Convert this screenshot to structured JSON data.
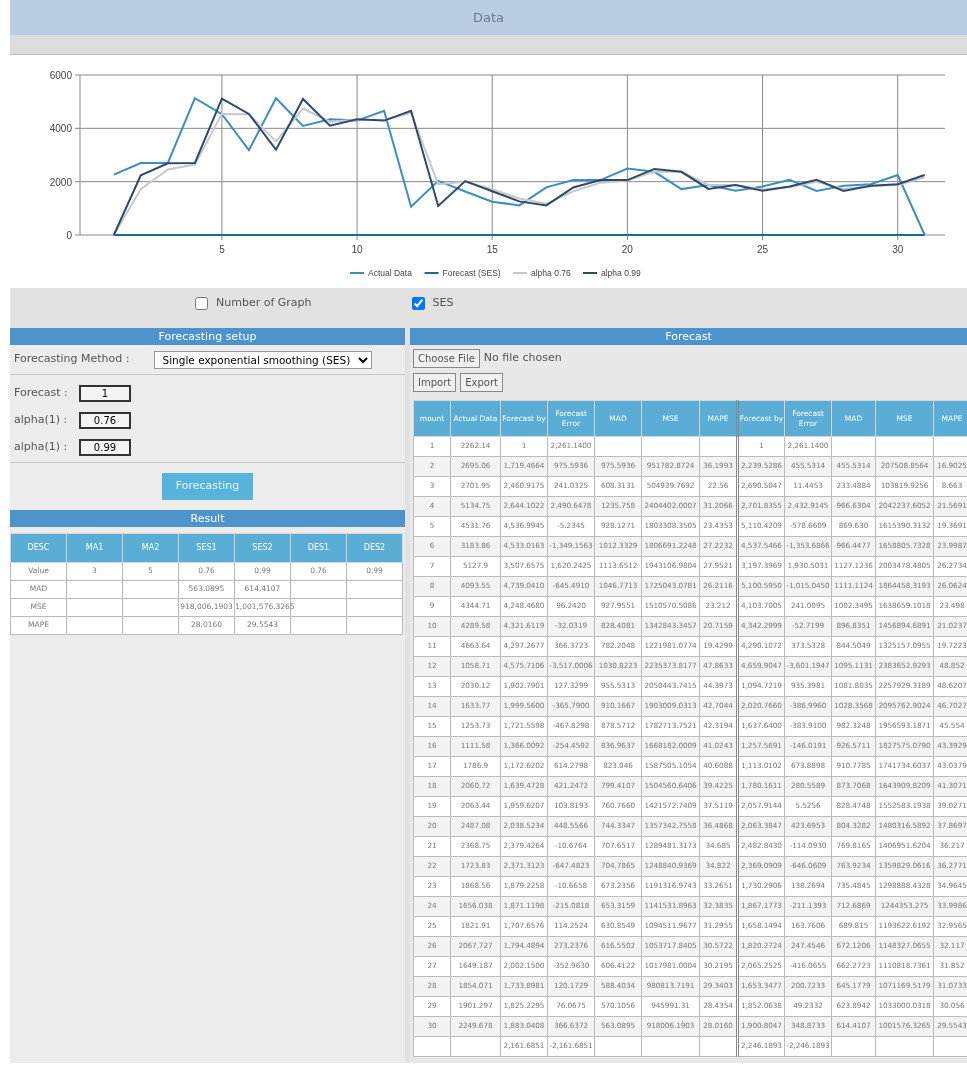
{
  "window": {
    "title": "Data"
  },
  "chart": {
    "chart_data": {
      "type": "line",
      "grid": true,
      "legend": "bottom",
      "x": [
        1,
        2,
        3,
        4,
        5,
        6,
        7,
        8,
        9,
        10,
        11,
        12,
        13,
        14,
        15,
        16,
        17,
        18,
        19,
        20,
        21,
        22,
        23,
        24,
        25,
        26,
        27,
        28,
        29,
        30,
        31
      ],
      "xlim": [
        -0.25,
        31.75
      ],
      "ylim": [
        0,
        6000
      ],
      "xticks": [
        5,
        10,
        15,
        20,
        25,
        30
      ],
      "yticks": [
        0,
        2000,
        4000,
        6000
      ],
      "series": [
        {
          "name": "Actual Data",
          "color": "#3a8fc1",
          "values": [
            2260,
            2700,
            2700,
            5130,
            4530,
            3180,
            5130,
            4090,
            4340,
            4290,
            4660,
            1060,
            2030,
            1630,
            1250,
            1110,
            1790,
            2060,
            2060,
            2490,
            2370,
            1720,
            1870,
            1660,
            1820,
            2070,
            1650,
            1850,
            1900,
            2250,
            0
          ]
        },
        {
          "name": "Forecast (SES)",
          "color": "#1d6a8c",
          "values": [
            0,
            0,
            0,
            0,
            0,
            0,
            0,
            0,
            0,
            0,
            0,
            0,
            0,
            0,
            0,
            0,
            0,
            0,
            0,
            0,
            0,
            0,
            0,
            0,
            0,
            0,
            0,
            0,
            0,
            0,
            0
          ]
        },
        {
          "name": "alpha 0.76",
          "color": "#c8c8c8",
          "values": [
            0,
            1720,
            2460,
            2640,
            4540,
            4530,
            3510,
            4740,
            4250,
            4320,
            4300,
            4580,
            1900,
            2000,
            1720,
            1370,
            1170,
            1640,
            1960,
            2040,
            2380,
            2370,
            1880,
            1870,
            1710,
            1790,
            2000,
            1730,
            1830,
            1880,
            2160
          ]
        },
        {
          "name": "alpha 0.99",
          "color": "#2e4a6b",
          "values": [
            0,
            2240,
            2690,
            2700,
            5110,
            4540,
            3200,
            5100,
            4100,
            4340,
            4290,
            4660,
            1090,
            2020,
            1640,
            1260,
            1110,
            1780,
            2060,
            2060,
            2480,
            2370,
            1730,
            1870,
            1660,
            1820,
            2070,
            1650,
            1850,
            1900,
            2250
          ]
        }
      ]
    }
  },
  "graph_options": [
    {
      "label": "Number of Graph",
      "checked": false
    },
    {
      "label": "SES",
      "checked": true
    }
  ],
  "setup": {
    "title": "Forecasting setup",
    "method_label": "Forecasting Method :",
    "method": "Single exponential smoothing (SES)",
    "fields": [
      {
        "label": "Forecast :",
        "value": "1"
      },
      {
        "label": "alpha(1) :",
        "value": "0.76"
      },
      {
        "label": "alpha(1) :",
        "value": "0.99"
      }
    ],
    "button": "Forecasting"
  },
  "result": {
    "title": "Result",
    "columns": [
      "DESC",
      "MA1",
      "MA2",
      "SES1",
      "SES2",
      "DES1",
      "DES2"
    ],
    "rows": [
      [
        "Value",
        "3",
        "5",
        "0.76",
        "0.99",
        "0.76",
        "0.99"
      ],
      [
        "MAD",
        null,
        null,
        "563.0895",
        "614.4107",
        null,
        null
      ],
      [
        "MSE",
        null,
        null,
        "918,006.1903",
        "1,001,576.3265",
        null,
        null
      ],
      [
        "MAPE",
        null,
        null,
        "28.0160",
        "29.5543",
        null,
        null
      ]
    ]
  },
  "forecast": {
    "title": "Forecast",
    "file_button": "Choose File",
    "file_status": "No file chosen",
    "buttons": [
      "Import",
      "Export"
    ],
    "table": {
      "columns": [
        "mount",
        "Actual Data",
        "Forecast by",
        "Forecast Error",
        "MAD",
        "MSE",
        "MAPE",
        "Forecast by",
        "Forecast Error",
        "MAD",
        "MSE",
        "MAPE"
      ],
      "rows": [
        [
          "1",
          "2262.14",
          "1",
          "2,261.1400",
          null,
          null,
          null,
          "1",
          "2,261.1400",
          null,
          null,
          null
        ],
        [
          "2",
          "2695.06",
          "1,719.4664",
          "975.5936",
          "975.5936",
          "951782.8724",
          "36.1993",
          "2,239.5286",
          "455.5314",
          "455.5314",
          "207508.8564",
          "16.9025"
        ],
        [
          "3",
          "2701.95",
          "2,460.9175",
          "241.0325",
          "608.3131",
          "504939.7692",
          "22.56",
          "2,690.5047",
          "11.4453",
          "233.4884",
          "103819.9256",
          "8.663"
        ],
        [
          "4",
          "5134.75",
          "2,644.1022",
          "2,490.6478",
          "1235.758",
          "2404402.0007",
          "31.2066",
          "2,701.8355",
          "2,432.9145",
          "966.6304",
          "2042237.6052",
          "21.5691"
        ],
        [
          "5",
          "4531.76",
          "4,536.9945",
          "-5.2345",
          "928.1271",
          "1803308.3505",
          "23.4353",
          "5,110.4209",
          "-578.6609",
          "869.630",
          "1615390.3132",
          "19.3691"
        ],
        [
          "6",
          "3183.86",
          "4,533.0163",
          "-1,349.1563",
          "1012.3329",
          "1806691.2248",
          "27.2232",
          "4,537.5466",
          "-1,353.6866",
          "966.4477",
          "1658805.7328",
          "23.9987"
        ],
        [
          "7",
          "5127.9",
          "3,507.6575",
          "1,620.2425",
          "1113.6512",
          "1943106.9804",
          "27.9521",
          "3,197.3969",
          "1,930.5031",
          "1127.1236",
          "2003478.4805",
          "26.2734"
        ],
        [
          "8",
          "4093.55",
          "4,739.0410",
          "-645.4910",
          "1046.7713",
          "1725043.0781",
          "26.2116",
          "5,100.5950",
          "-1,015.0450",
          "1111.1124",
          "1864458.3193",
          "26.0624"
        ],
        [
          "9",
          "4344.71",
          "4,248.4680",
          "96.2420",
          "927.9551",
          "1510570.5086",
          "23.212",
          "4,103.7005",
          "241.0095",
          "1002.3495",
          "1638659.1018",
          "23.498"
        ],
        [
          "10",
          "4289.58",
          "4,321.6119",
          "-32.0319",
          "828.4081",
          "1342843.3457",
          "20.7159",
          "4,342.2999",
          "-52.7199",
          "896.8351",
          "1456894.6891",
          "21.0237"
        ],
        [
          "11",
          "4663.64",
          "4,297.2677",
          "366.3723",
          "782.2048",
          "1221981.0774",
          "19.4299",
          "4,290.1072",
          "373.5328",
          "844.5049",
          "1325157.0955",
          "19.7223"
        ],
        [
          "12",
          "1058.71",
          "4,575.7106",
          "-3,517.0006",
          "1030.8223",
          "2235373.8177",
          "47.8633",
          "4,659.9047",
          "-3,601.1947",
          "1095.1131",
          "2383652.9293",
          "48.852"
        ],
        [
          "13",
          "2030.12",
          "1,902.7901",
          "127.3299",
          "955.5313",
          "2050443.7415",
          "44.3973",
          "1,094.7219",
          "935.3981",
          "1081.8035",
          "2257929.3189",
          "48.6207"
        ],
        [
          "14",
          "1633.77",
          "1,999.5600",
          "-365.7900",
          "910.1667",
          "1903009.0313",
          "42.7044",
          "2,020.7660",
          "-386.9960",
          "1028.3568",
          "2095762.9024",
          "46.7027"
        ],
        [
          "15",
          "1253.73",
          "1,721.5598",
          "-467.8298",
          "878.5712",
          "1782713.7521",
          "42.3194",
          "1,637.6400",
          "-383.9100",
          "982.3248",
          "1956593.1871",
          "45.554"
        ],
        [
          "16",
          "1111.58",
          "1,366.0092",
          "-254.4592",
          "836.9637",
          "1668182.0009",
          "41.0243",
          "1,257.5691",
          "-146.0191",
          "926.5711",
          "1827575.0790",
          "43.3929"
        ],
        [
          "17",
          "1786.9",
          "1,172.6202",
          "614.2798",
          "823.046",
          "1587505.1054",
          "40.6088",
          "1,113.0102",
          "673.8898",
          "910.7785",
          "1741734.6037",
          "43.0379"
        ],
        [
          "18",
          "2060.72",
          "1,639.4728",
          "421.2472",
          "799.4107",
          "1504560.6406",
          "39.4225",
          "1,780.1611",
          "280.5589",
          "873.7068",
          "1643909.8209",
          "41.3071"
        ],
        [
          "19",
          "2063.44",
          "1,959.6207",
          "103.8193",
          "760.7660",
          "1421572.7409",
          "37.5119",
          "2,057.9144",
          "5.5256",
          "828.4748",
          "1552583.1938",
          "39.0271"
        ],
        [
          "20",
          "2487.08",
          "2,038.5234",
          "448.5566",
          "744.3347",
          "1357342.7558",
          "36.4868",
          "2,063.3847",
          "423.6953",
          "804.3282",
          "1480316.5892",
          "37.8697"
        ],
        [
          "21",
          "2368.75",
          "2,379.4264",
          "-10.6764",
          "707.6517",
          "1289481.3173",
          "34.685",
          "2,482.8430",
          "-114.0930",
          "769.8165",
          "1406951.6204",
          "36.217"
        ],
        [
          "22",
          "1723.83",
          "2,371.3123",
          "-647.4823",
          "704.7865",
          "1248840.9369",
          "34.822",
          "2,369.0909",
          "-646.0609",
          "763.9234",
          "1359829.0616",
          "36.2771"
        ],
        [
          "23",
          "1868.56",
          "1,879.2258",
          "-10.6658",
          "673.2356",
          "1191316.9743",
          "33.2651",
          "1,730.2906",
          "138.2694",
          "735.4845",
          "1298888.4328",
          "34.9645"
        ],
        [
          "24",
          "1656.038",
          "1,871.1198",
          "-215.0818",
          "653.3159",
          "1141531.8963",
          "32.3835",
          "1,867.1773",
          "-211.1393",
          "712.6869",
          "1244353.275",
          "33.9986"
        ],
        [
          "25",
          "1821.91",
          "1,707.6576",
          "114.2524",
          "630.8549",
          "1094511.9677",
          "31.2955",
          "1,658.1494",
          "163.7606",
          "689.815",
          "1193622.6192",
          "32.9565"
        ],
        [
          "26",
          "2067.727",
          "1,794.4894",
          "273.2376",
          "616.5502",
          "1053717.8405",
          "30.5722",
          "1,820.2724",
          "247.4546",
          "672.1206",
          "1148327.0655",
          "32.117"
        ],
        [
          "27",
          "1649.187",
          "2,002.1500",
          "-352.9630",
          "606.4122",
          "1017981.0004",
          "30.2195",
          "2,065.2525",
          "-416.0655",
          "662.2723",
          "1110818.7361",
          "31.852"
        ],
        [
          "28",
          "1854.071",
          "1,733.8981",
          "120.1729",
          "588.4034",
          "980813.7191",
          "29.3403",
          "1,653.3477",
          "200.7233",
          "645.1779",
          "1071169.5179",
          "31.0733"
        ],
        [
          "29",
          "1901.297",
          "1,825.2295",
          "76.0675",
          "570.1056",
          "945991.31",
          "28.4354",
          "1,852.0638",
          "49.2332",
          "623.8942",
          "1033000.0318",
          "30.056"
        ],
        [
          "30",
          "2249.678",
          "1,883.0408",
          "366.6372",
          "563.0895",
          "918006.1903",
          "28.0160",
          "1,900.8047",
          "348.8733",
          "614.4107",
          "1001576.3265",
          "29.5543"
        ],
        [
          null,
          null,
          "2,161.6851",
          "-2,161.6851",
          null,
          null,
          null,
          "2,246.1893",
          "-2,246.1893",
          null,
          null,
          null
        ]
      ]
    }
  }
}
